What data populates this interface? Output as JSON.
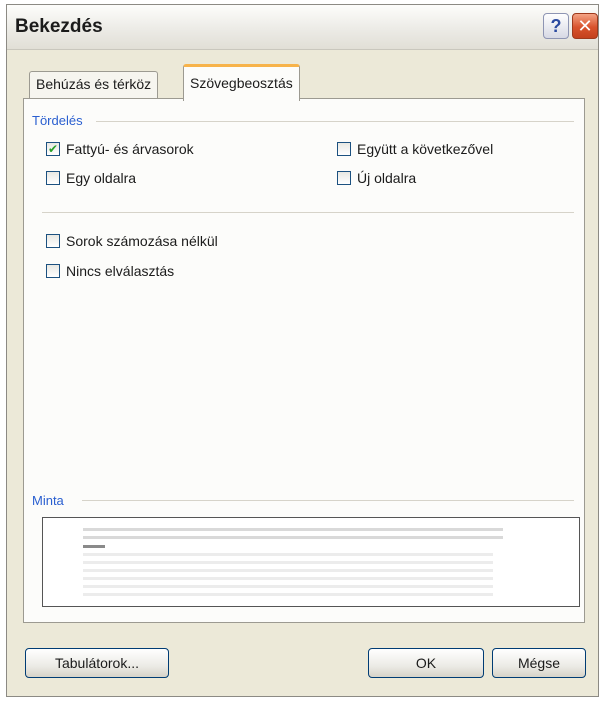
{
  "dialog": {
    "title": "Bekezdés",
    "help_glyph": "?",
    "close_glyph": "✕"
  },
  "tabs": [
    {
      "label": "Behúzás és térköz",
      "active": false
    },
    {
      "label": "Szövegbeosztás",
      "active": true
    }
  ],
  "pagination": {
    "group_label": "Tördelés",
    "checkboxes": [
      {
        "label": "Fattyú- és árvasorok",
        "checked": true
      },
      {
        "label": "Együtt a következővel",
        "checked": false
      },
      {
        "label": "Egy oldalra",
        "checked": false
      },
      {
        "label": "Új oldalra",
        "checked": false
      }
    ]
  },
  "other_options": [
    {
      "label": "Sorok számozása nélkül",
      "checked": false
    },
    {
      "label": "Nincs elválasztás",
      "checked": false
    }
  ],
  "preview": {
    "group_label": "Minta"
  },
  "buttons": {
    "tabs_label": "Tabulátorok...",
    "ok_label": "OK",
    "cancel_label": "Mégse"
  },
  "colors": {
    "dialog_bg": "#ece9d8",
    "group_label": "#2a5fd0",
    "active_tab_accent": "#f7b34a",
    "close_button": "#d8532c"
  }
}
